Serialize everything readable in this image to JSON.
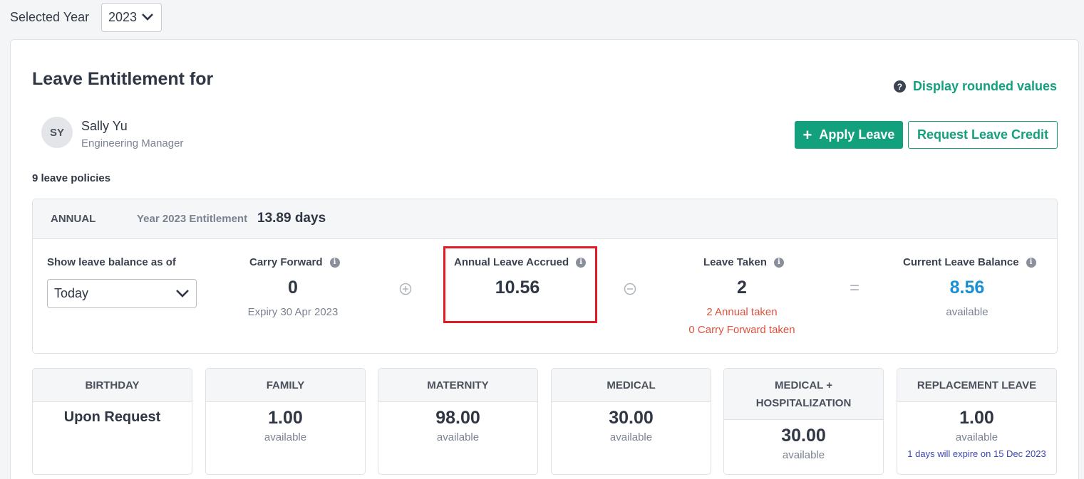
{
  "year_bar": {
    "label": "Selected Year",
    "selected_year": "2023"
  },
  "header": {
    "title": "Leave Entitlement for",
    "rounded_link": "Display rounded values",
    "apply_button": "Apply Leave",
    "credit_button": "Request Leave Credit"
  },
  "user": {
    "initials": "SY",
    "name": "Sally Yu",
    "role": "Engineering Manager"
  },
  "policies_count": "9 leave policies",
  "annual": {
    "type": "ANNUAL",
    "entitlement_label": "Year 2023 Entitlement",
    "entitlement_value": "13.89 days",
    "balance_as_of_label": "Show leave balance as of",
    "balance_as_of_value": "Today",
    "carry_forward": {
      "label": "Carry Forward",
      "value": "0",
      "sub": "Expiry 30 Apr 2023"
    },
    "accrued": {
      "label": "Annual Leave Accrued",
      "value": "10.56"
    },
    "taken": {
      "label": "Leave Taken",
      "value": "2",
      "sub1": "2 Annual taken",
      "sub2": "0 Carry Forward taken"
    },
    "balance": {
      "label": "Current Leave Balance",
      "value": "8.56",
      "sub": "available"
    },
    "operators": {
      "plus": "⊕",
      "minus": "⊖",
      "equals": "="
    }
  },
  "other_policies": [
    {
      "name": "BIRTHDAY",
      "value": "Upon Request",
      "sub": ""
    },
    {
      "name": "FAMILY",
      "value": "1.00",
      "sub": "available"
    },
    {
      "name": "MATERNITY",
      "value": "98.00",
      "sub": "available"
    },
    {
      "name": "MEDICAL",
      "value": "30.00",
      "sub": "available"
    },
    {
      "name": "MEDICAL + HOSPITALIZATION",
      "value": "30.00",
      "sub": "available"
    },
    {
      "name": "REPLACEMENT LEAVE",
      "value": "1.00",
      "sub": "available",
      "note": "1 days will expire on 15 Dec 2023"
    }
  ],
  "colors": {
    "accent": "#13a07d",
    "balance": "#1a8fd1",
    "taken": "#e0503d",
    "highlight": "#e01b24",
    "note": "#3b45b5"
  },
  "icons": [
    "chevron-down-icon",
    "question-icon",
    "plus-icon",
    "info-icon",
    "plus-circle-icon",
    "minus-circle-icon"
  ]
}
